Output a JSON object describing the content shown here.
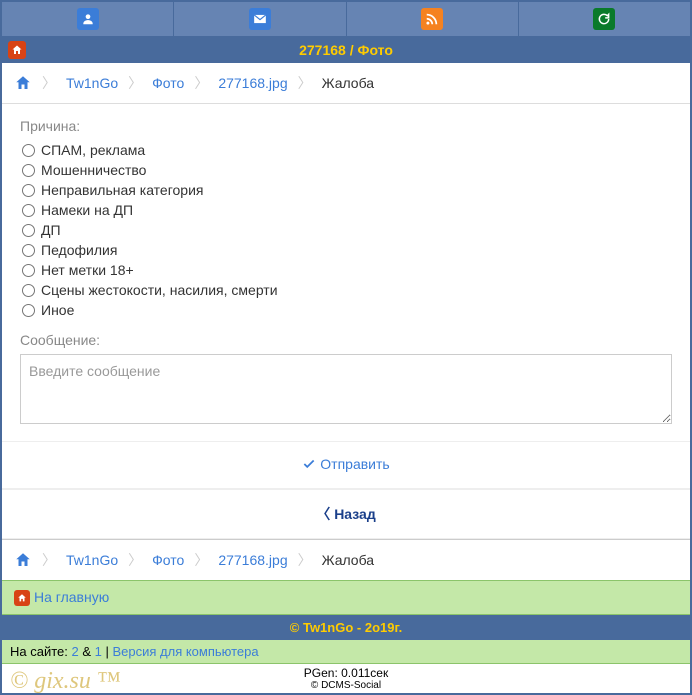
{
  "title": "277168 / Фото",
  "breadcrumb": {
    "items": [
      "Tw1nGo",
      "Фото",
      "277168.jpg"
    ],
    "current": "Жалоба"
  },
  "form": {
    "reason_label": "Причина:",
    "reasons": [
      "СПАМ, реклама",
      "Мошенничество",
      "Неправильная категория",
      "Намеки на ДП",
      "ДП",
      "Педофилия",
      "Нет метки 18+",
      "Сцены жестокости, насилия, смерти",
      "Иное"
    ],
    "message_label": "Сообщение:",
    "message_placeholder": "Введите сообщение",
    "submit": "Отправить",
    "back": "Назад"
  },
  "home_link": "На главную",
  "copyright": "© Tw1nGo - 2о19г.",
  "footer": {
    "online_label": "На сайте:",
    "count1": "2",
    "amp": " & ",
    "count2": "1",
    "sep": " | ",
    "version": "Версия для компьютера",
    "pgen": "PGen: 0.011сек",
    "dcms": "© DCMS-Social"
  },
  "watermark": "© gix.su ™"
}
